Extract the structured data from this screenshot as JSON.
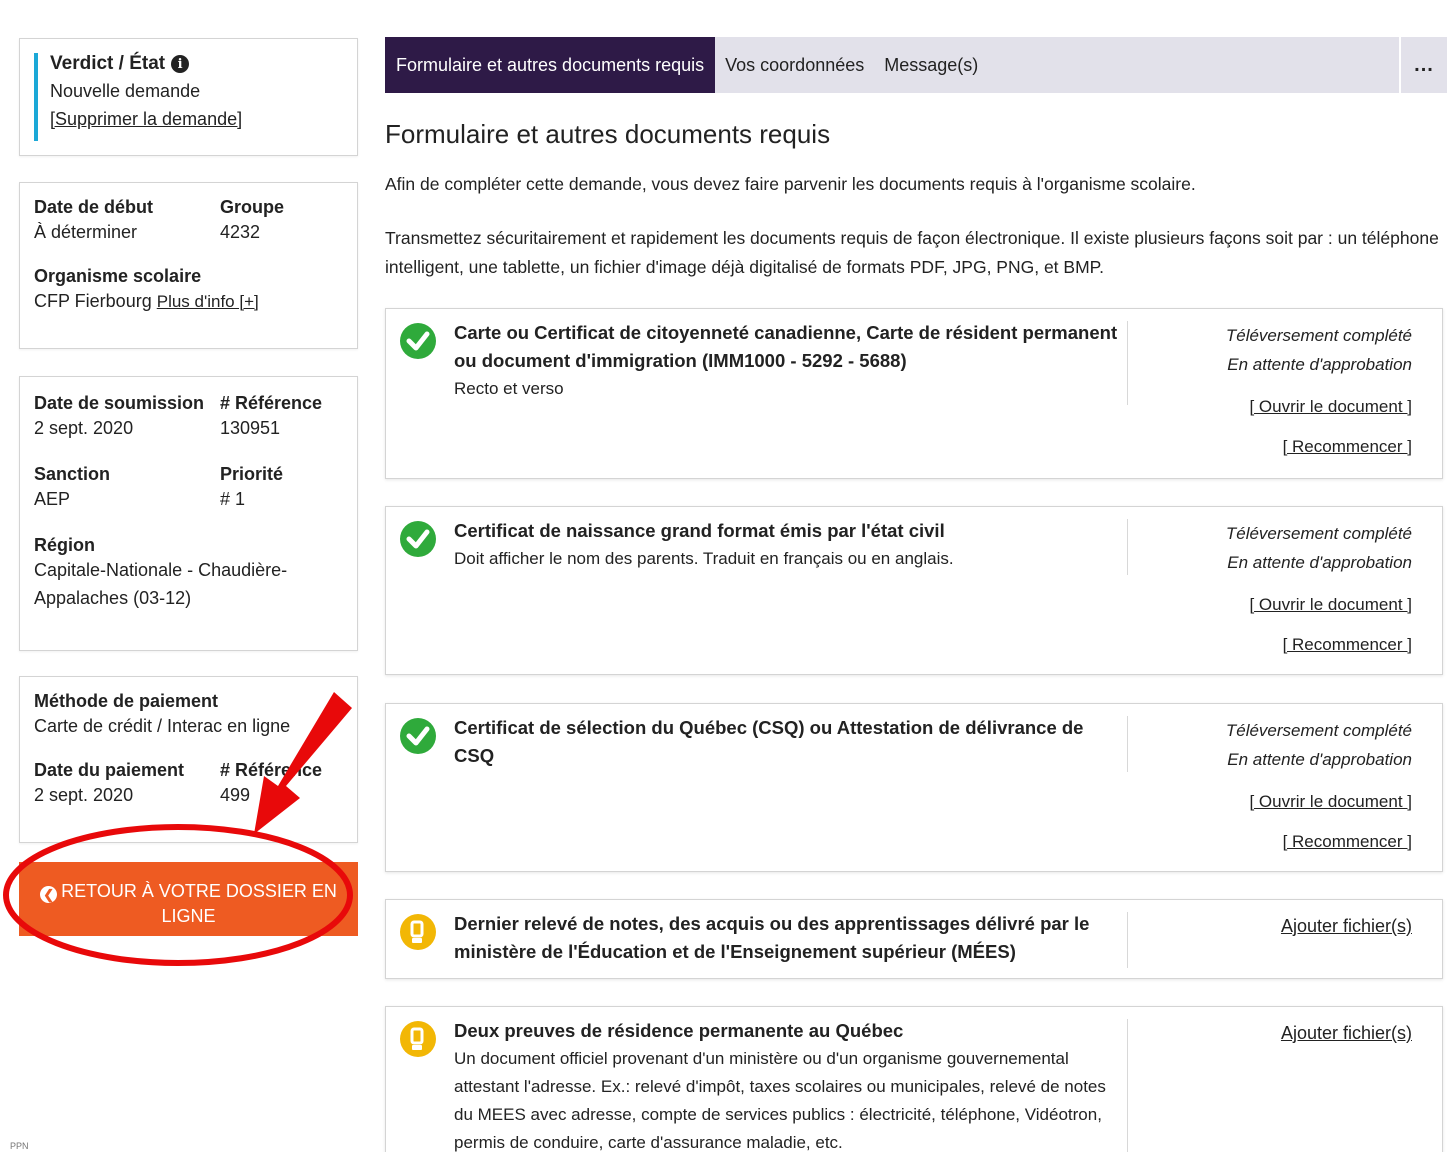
{
  "left": {
    "verdict": {
      "title": "Verdict / État",
      "status": "Nouvelle demande",
      "delete_link": "[Supprimer la demande]"
    },
    "start": {
      "date_label": "Date de début",
      "date_value": "À déterminer",
      "group_label": "Groupe",
      "group_value": "4232",
      "org_label": "Organisme scolaire",
      "org_value": "CFP Fierbourg",
      "org_link": "Plus d'info [+]"
    },
    "submission": {
      "date_label": "Date de soumission",
      "date_value": "2 sept. 2020",
      "ref_label": "# Référence",
      "ref_value": "130951",
      "sanction_label": "Sanction",
      "sanction_value": "AEP",
      "priority_label": "Priorité",
      "priority_value": "# 1",
      "region_label": "Région",
      "region_value": "Capitale-Nationale - Chaudière-Appalaches (03-12)"
    },
    "payment": {
      "method_label": "Méthode de paiement",
      "method_value": "Carte de crédit / Interac en ligne",
      "date_label": "Date du paiement",
      "date_value": "2 sept. 2020",
      "ref_label": "# Référence",
      "ref_value": "499"
    },
    "return_button": "RETOUR À VOTRE DOSSIER EN LIGNE",
    "corner_text": "PPN"
  },
  "tabs": [
    {
      "label": "Formulaire et autres documents requis",
      "active": true
    },
    {
      "label": "Vos coordonnées",
      "active": false
    },
    {
      "label": "Message(s)",
      "active": false
    }
  ],
  "more_label": "...",
  "main": {
    "title": "Formulaire et autres documents requis",
    "intro": "Afin de compléter cette demande, vous devez faire parvenir les documents requis à l'organisme scolaire.",
    "instructions": "Transmettez sécuritairement et rapidement les documents requis de façon électronique. Il existe plusieurs façons soit par : un téléphone intelligent, une tablette, un fichier d'image déjà digitalisé de formats PDF, JPG, PNG, et BMP."
  },
  "documents": [
    {
      "status": "done",
      "title": "Carte ou Certificat de citoyenneté canadienne, Carte de résident permanent ou document d'immigration (IMM1000 - 5292 - 5688)",
      "desc": "Recto et verso",
      "upload_status": "Téléversement complété",
      "approval_status": "En attente d'approbation",
      "open_link": "[ Ouvrir le document ]",
      "restart_link": "[ Recommencer ]"
    },
    {
      "status": "done",
      "title": "Certificat de naissance grand format émis par l'état civil",
      "desc": "Doit afficher le nom des parents. Traduit en français ou en anglais.",
      "upload_status": "Téléversement complété",
      "approval_status": "En attente d'approbation",
      "open_link": "[ Ouvrir le document ]",
      "restart_link": "[ Recommencer ]"
    },
    {
      "status": "done",
      "title": "Certificat de sélection du Québec (CSQ) ou Attestation de délivrance de CSQ",
      "desc": "",
      "upload_status": "Téléversement complété",
      "approval_status": "En attente d'approbation",
      "open_link": "[ Ouvrir le document ]",
      "restart_link": "[ Recommencer ]"
    },
    {
      "status": "pending",
      "title": "Dernier relevé de notes, des acquis ou des apprentissages délivré par le ministère de l'Éducation et de l'Enseignement supérieur (MÉES)",
      "desc": "",
      "add_link": "Ajouter fichier(s)"
    },
    {
      "status": "pending",
      "title": "Deux preuves de résidence permanente au Québec",
      "desc": "Un document officiel provenant d'un ministère ou d'un organisme gouvernemental attestant l'adresse. Ex.: relevé d'impôt, taxes scolaires ou municipales, relevé de notes du MEES avec adresse, compte de services publics : électricité, téléphone, Vidéotron, permis de conduire, carte d'assurance maladie, etc.",
      "add_link": "Ajouter fichier(s)"
    }
  ],
  "colors": {
    "accent_tab": "#2e1a47",
    "tabbar_bg": "#e2e1ea",
    "button_orange": "#ee5b22",
    "verdict_bar": "#1ba8d7",
    "check_green": "#2faa3b",
    "warning_yellow": "#f2b705",
    "annotation_red": "#e8090a"
  }
}
